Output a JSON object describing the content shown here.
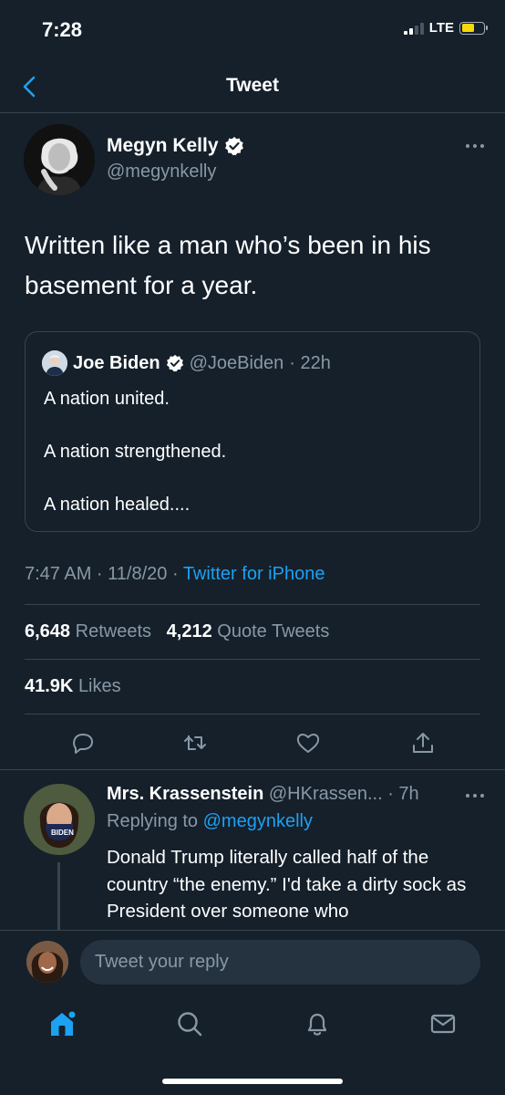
{
  "status_bar": {
    "time": "7:28",
    "network": "LTE"
  },
  "header": {
    "title": "Tweet"
  },
  "tweet": {
    "author_name": "Megyn Kelly",
    "author_handle": "@megynkelly",
    "verified": true,
    "text_line1": "Written like a man who’s been in his",
    "text_line2": "basement for a year.",
    "timestamp": "7:47 AM · 11/8/20 · ",
    "source": "Twitter for iPhone"
  },
  "quote": {
    "author_name": "Joe Biden",
    "author_handle": "@JoeBiden",
    "time": "· 22h",
    "lines": [
      "A nation united.",
      "A nation strengthened.",
      "A nation healed...."
    ]
  },
  "stats": {
    "retweets_count": "6,648",
    "retweets_label": "Retweets",
    "quotes_count": "4,212",
    "quotes_label": "Quote Tweets",
    "likes_count": "41.9K",
    "likes_label": "Likes"
  },
  "reply": {
    "author_name": "Mrs. Krassenstein",
    "author_handle": "@HKrassen...",
    "time": "· 7h",
    "replying_prefix": "Replying to ",
    "replying_handle": "@megynkelly",
    "text": "Donald Trump literally called half of the country “the enemy.” I'd take a dirty sock as President over someone who"
  },
  "composer": {
    "placeholder": "Tweet your reply"
  },
  "icons": {
    "actions": [
      "reply-icon",
      "retweet-icon",
      "like-icon",
      "share-icon"
    ],
    "tabs": [
      "home-icon",
      "search-icon",
      "notifications-icon",
      "messages-icon"
    ]
  },
  "colors": {
    "background": "#15202b",
    "accent": "#1da1f2",
    "muted": "#8899a6",
    "border": "#38444d"
  }
}
